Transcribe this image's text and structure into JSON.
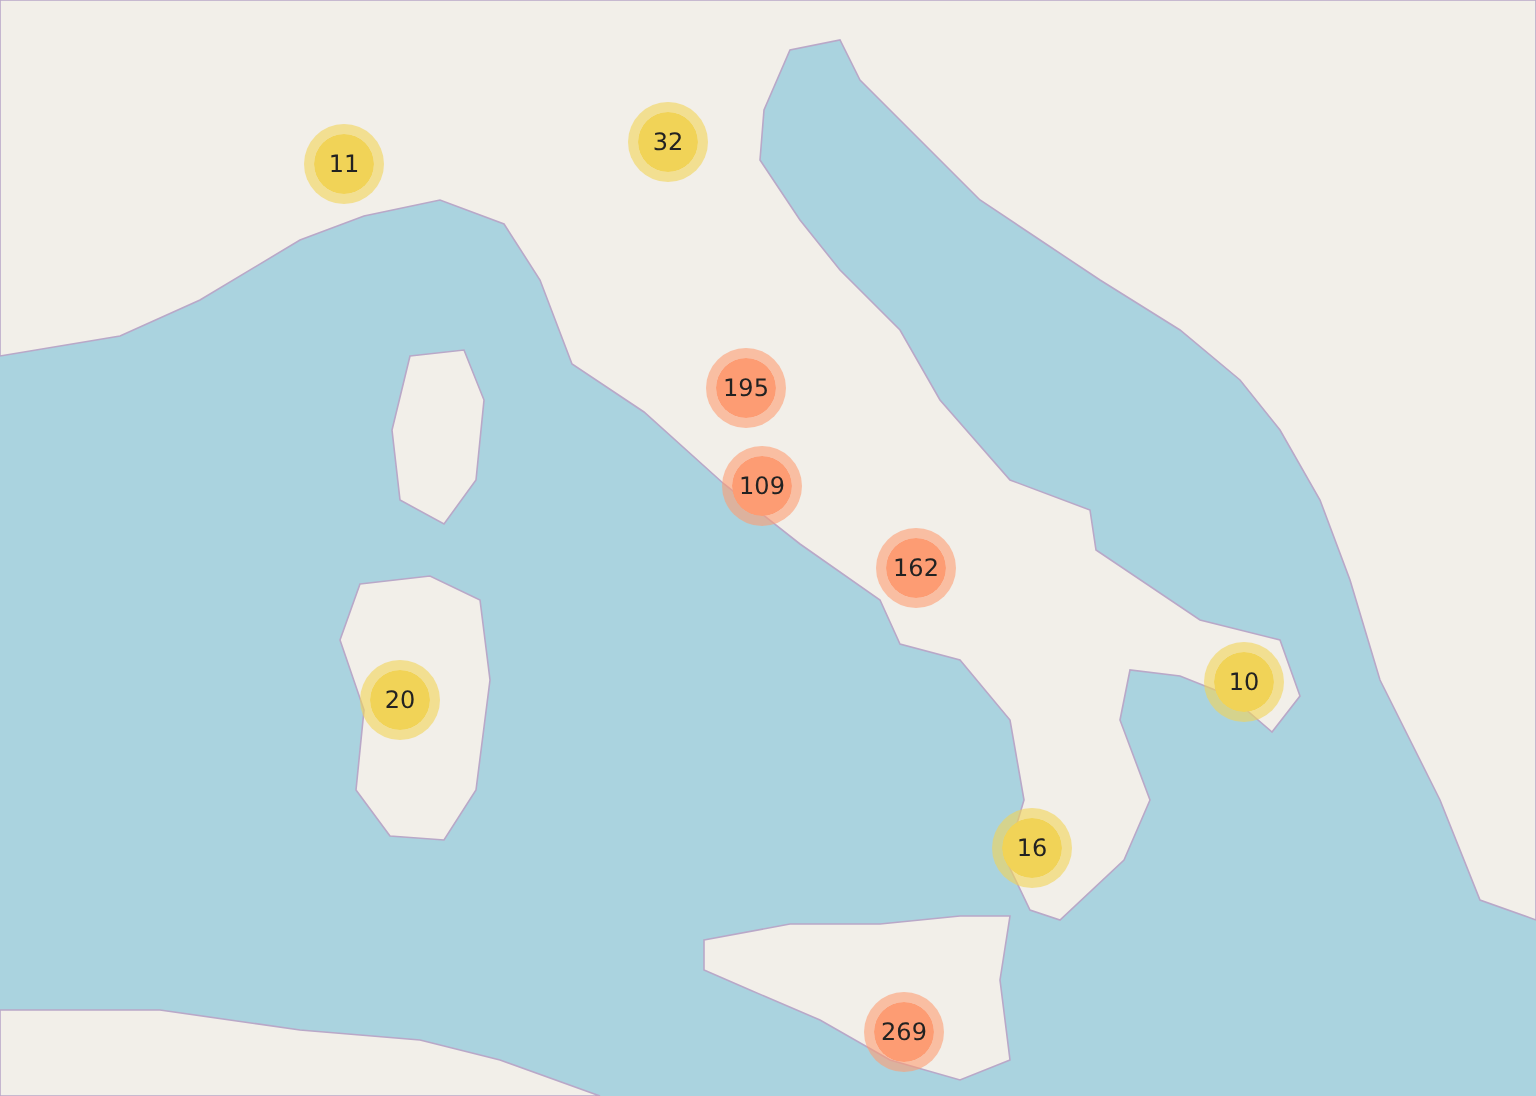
{
  "map": {
    "clusters": [
      {
        "count": "11",
        "color": "#f1d357"
      },
      {
        "count": "32",
        "color": "#f1d357"
      },
      {
        "count": "195",
        "color": "#fd9c73"
      },
      {
        "count": "109",
        "color": "#fd9c73"
      },
      {
        "count": "162",
        "color": "#fd9c73"
      },
      {
        "count": "20",
        "color": "#f1d357"
      },
      {
        "count": "10",
        "color": "#f1d357"
      },
      {
        "count": "16",
        "color": "#f1d357"
      },
      {
        "count": "269",
        "color": "#fd9c73"
      }
    ]
  }
}
